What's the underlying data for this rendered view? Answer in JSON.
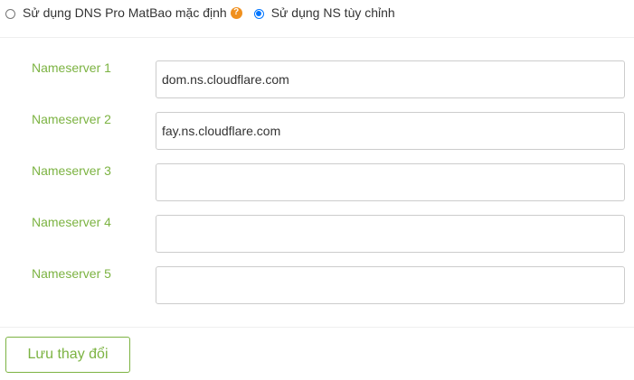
{
  "dns_mode": {
    "options": [
      {
        "label": "Sử dụng DNS Pro MatBao mặc định",
        "checked": false,
        "help_icon": "question-circle-icon"
      },
      {
        "label": "Sử dụng NS tùy chỉnh",
        "checked": true
      }
    ]
  },
  "nameservers": [
    {
      "label": "Nameserver 1",
      "value": "dom.ns.cloudflare.com"
    },
    {
      "label": "Nameserver 2",
      "value": "fay.ns.cloudflare.com"
    },
    {
      "label": "Nameserver 3",
      "value": ""
    },
    {
      "label": "Nameserver 4",
      "value": ""
    },
    {
      "label": "Nameserver 5",
      "value": ""
    }
  ],
  "actions": {
    "save_label": "Lưu thay đổi"
  },
  "colors": {
    "accent_green": "#7cb342",
    "help_orange": "#f0901e",
    "radio_blue": "#0075ff"
  }
}
